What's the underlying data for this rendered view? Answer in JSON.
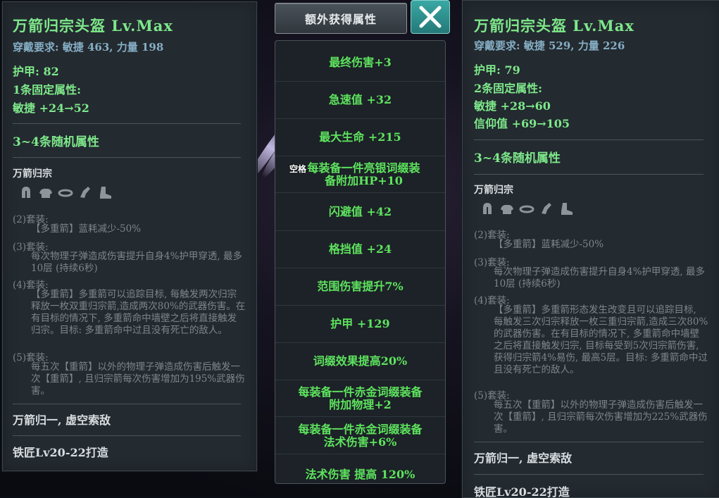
{
  "left_item": {
    "title": "万箭归宗头盔  Lv.Max",
    "requirement": "穿戴要求: 敏捷 463, 力量 198",
    "armor": "护甲:  82",
    "fixed_count": "1条固定属性:",
    "fixed_stats": [
      "敏捷  +24→52"
    ],
    "random_label": "3~4条随机属性",
    "set_name": "万箭归宗",
    "set_icons": [
      "helmet-icon",
      "shoulder-armor-icon",
      "belt-icon",
      "gauntlet-icon",
      "boots-icon"
    ],
    "bonuses": [
      {
        "label": "(2)套装:",
        "text": "【多重箭】蓝耗减少-50%"
      },
      {
        "label": "(3)套装:",
        "text": "每次物理子弹造成伤害提升自身4%护甲穿透, 最多10层 (持续6秒)"
      },
      {
        "label": "(4)套装:",
        "text": "【多重箭】多重箭可以追踪目标, 每触发两次归宗释放一枚双重归宗箭,造成两次80%的武器伤害。在有目标的情况下, 多重箭命中墙壁之后将直接触发归宗。目标: 多重箭命中过且没有死亡的敌人。"
      },
      {
        "label": "(5)套装:",
        "text": "每五次【重箭】以外的物理子弹造成伤害后触发一次【重箭】, 且归宗箭每次伤害增加为195%武器伤害。"
      }
    ],
    "flavor": "万箭归一, 虚空索敌",
    "crafter": "铁匠Lv20-22打造"
  },
  "right_item": {
    "title": "万箭归宗头盔  Lv.Max",
    "requirement": "穿戴要求: 敏捷 529, 力量 226",
    "armor": "护甲:  79",
    "fixed_count": "2条固定属性:",
    "fixed_stats": [
      "敏捷  +28→60",
      "信仰值  +69→105"
    ],
    "random_label": "3~4条随机属性",
    "set_name": "万箭归宗",
    "set_icons": [
      "helmet-icon",
      "shoulder-armor-icon",
      "belt-icon",
      "gauntlet-icon",
      "boots-icon"
    ],
    "bonuses": [
      {
        "label": "(2)套装:",
        "text": "【多重箭】蓝耗减少-50%"
      },
      {
        "label": "(3)套装:",
        "text": "每次物理子弹造成伤害提升自身4%护甲穿透, 最多10层 (持续6秒)"
      },
      {
        "label": "(4)套装:",
        "text": "【多重箭】多重箭形态发生改变且可以追踪目标, 每触发三次归宗释放一枚三重归宗箭,造成三次80%的武器伤害。在有目标的情况下, 多重箭命中墙壁之后将直接触发归宗, 目标每受到5次归宗箭伤害, 获得归宗箭4%易伤, 最高5层。目标: 多重箭命中过且没有死亡的敌人。"
      },
      {
        "label": "(5)套装:",
        "text": "每五次【重箭】以外的物理子弹造成伤害后触发一次【重箭】, 且归宗箭每次伤害增加为225%武器伤害。"
      }
    ],
    "flavor": "万箭归一, 虚空索敌",
    "crafter": "铁匠Lv20-22打造"
  },
  "extra_attributes": {
    "button_label": "额外获得属性",
    "hotkey_hint": "空格",
    "items": [
      "最终伤害+3",
      "急速值  +32",
      "最大生命  +215",
      "每装备一件亮银词缀装备附加HP+10",
      "闪避值  +42",
      "格挡值  +24",
      "范围伤害提升7%",
      "护甲  +129",
      "词缀效果提高20%",
      "每装备一件赤金词缀装备附加物理+2",
      "每装备一件赤金词缀装备法术伤害+6%",
      "法术伤害  提高  120%"
    ]
  },
  "colors": {
    "accent_green": "#7ee88a",
    "attr_green": "#5ee35e",
    "requirement_blue": "#86aec4",
    "panel_bg": "#232a30",
    "close_teal": "#2f928f"
  }
}
